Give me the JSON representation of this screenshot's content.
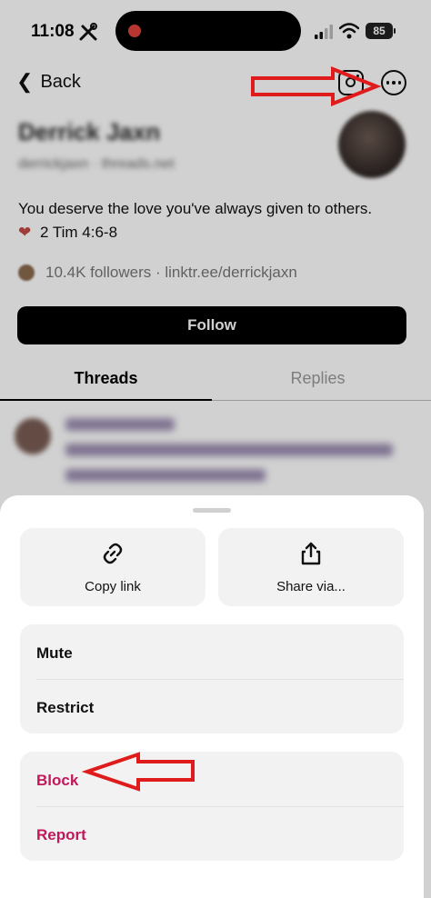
{
  "status_bar": {
    "time": "11:08",
    "battery": "85"
  },
  "header": {
    "back_label": "Back"
  },
  "profile": {
    "name": "Derrick Jaxn",
    "handle": "derrickjaxn · threads.net",
    "bio_line1": "You deserve the love you've always given to others.",
    "bio_line2": "2 Tim 4:6-8",
    "followers": "10.4K followers · linktr.ee/derrickjaxn",
    "follow_label": "Follow"
  },
  "tabs": [
    {
      "label": "Threads",
      "active": true
    },
    {
      "label": "Replies",
      "active": false
    }
  ],
  "sheet": {
    "copy_link_label": "Copy link",
    "share_via_label": "Share via...",
    "mute_label": "Mute",
    "restrict_label": "Restrict",
    "block_label": "Block",
    "report_label": "Report"
  },
  "colors": {
    "destructive": "#c2185b",
    "annotation": "#e01b1b",
    "follow_bg": "#000000"
  },
  "icons": [
    "tools-icon",
    "signal-icon",
    "wifi-icon",
    "instagram-icon",
    "more-icon",
    "link-icon",
    "share-icon",
    "heart-icon"
  ]
}
